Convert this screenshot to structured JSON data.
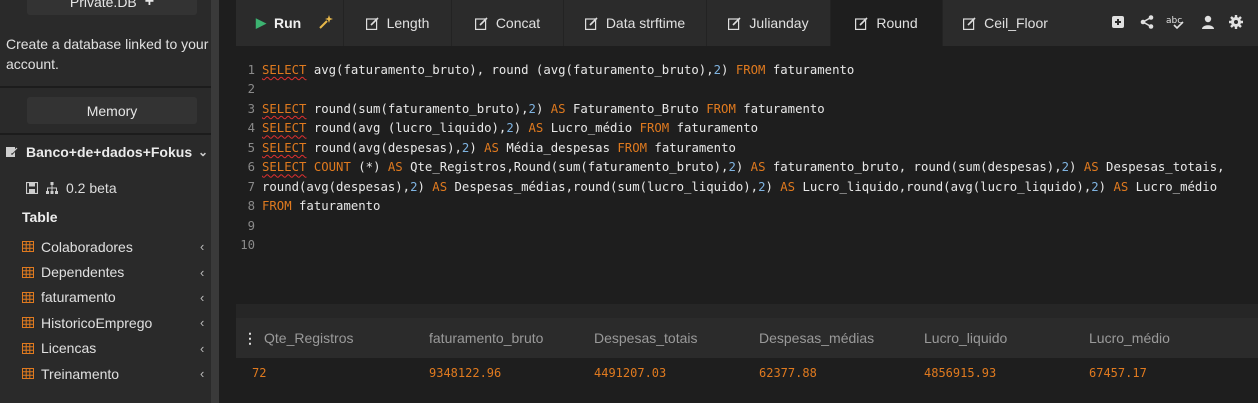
{
  "sidebar": {
    "top_button_label": "Private.DB",
    "create_text": "Create a database linked to your account.",
    "memory_label": "Memory",
    "database_name": "Banco+de+dados+Fokus",
    "version": "0.2 beta",
    "table_heading": "Table",
    "tables": [
      "Colaboradores",
      "Dependentes",
      "faturamento",
      "HistoricoEmprego",
      "Licencas",
      "Treinamento"
    ]
  },
  "toolbar": {
    "run_label": "Run",
    "tabs": [
      "Length",
      "Concat",
      "Data strftime",
      "Julianday",
      "Round",
      "Ceil_Floor"
    ],
    "active_tab": "Round",
    "tools": [
      "add-icon",
      "share-icon",
      "spellcheck-icon",
      "user-icon",
      "settings-icon"
    ]
  },
  "editor": {
    "line_numbers": [
      "1",
      "2",
      "3",
      "4",
      "5",
      "6",
      "7",
      "8",
      "9",
      "10"
    ],
    "lines": [
      "SELECT avg(faturamento_bruto), round (avg(faturamento_bruto),2) FROM faturamento",
      "",
      "SELECT round(sum(faturamento_bruto),2) AS Faturamento_Bruto FROM faturamento",
      "SELECT round(avg (lucro_liquido),2) AS Lucro_médio FROM faturamento",
      "SELECT round(avg(despesas),2) AS Média_despesas FROM faturamento",
      "SELECT COUNT (*) AS Qte_Registros,Round(sum(faturamento_bruto),2) AS faturamento_bruto, round(sum(despesas),2) AS Despesas_totais,",
      "round(avg(despesas),2) AS Despesas_médias,round(sum(lucro_liquido),2) AS Lucro_liquido,round(avg(lucro_liquido),2) AS Lucro_médio",
      "FROM faturamento",
      "",
      ""
    ]
  },
  "results": {
    "columns": [
      "Qte_Registros",
      "faturamento_bruto",
      "Despesas_totais",
      "Despesas_médias",
      "Lucro_liquido",
      "Lucro_médio"
    ],
    "rows": [
      [
        "72",
        "9348122.96",
        "4491207.03",
        "62377.88",
        "4856915.93",
        "67457.17"
      ]
    ]
  },
  "colors": {
    "keyword": "#e07a1f",
    "number": "#7fb3e0",
    "run_icon": "#3cb371",
    "result_value": "#e07a1f"
  }
}
